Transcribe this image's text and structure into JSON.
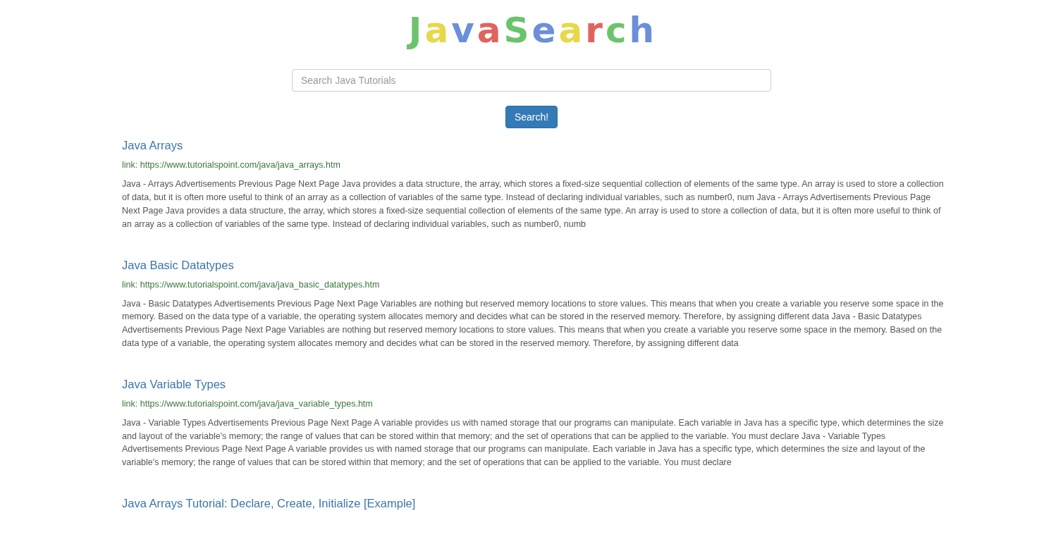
{
  "logo": {
    "letters": [
      {
        "char": "J",
        "color": "#6cc36c"
      },
      {
        "char": "a",
        "color": "#e6d84a"
      },
      {
        "char": "v",
        "color": "#6b8fd8"
      },
      {
        "char": "a",
        "color": "#e0635c"
      },
      {
        "char": "S",
        "color": "#6cc36c"
      },
      {
        "char": "e",
        "color": "#6b8fd8"
      },
      {
        "char": "a",
        "color": "#e6d84a"
      },
      {
        "char": "r",
        "color": "#e0635c"
      },
      {
        "char": "c",
        "color": "#6cc36c"
      },
      {
        "char": "h",
        "color": "#6b8fd8"
      }
    ]
  },
  "search": {
    "placeholder": "Search Java Tutorials",
    "button": "Search!"
  },
  "results": [
    {
      "title": "Java Arrays",
      "link": "link: https://www.tutorialspoint.com/java/java_arrays.htm",
      "snippet": "Java - Arrays Advertisements Previous Page Next Page   Java provides a data structure, the array, which stores a fixed-size sequential collection of elements of the same type. An array is used to store a collection of data, but it is often more useful to think of an array as a collection of variables of the same type. Instead of declaring individual variables, such as number0, num Java - Arrays Advertisements Previous Page Next Page   Java provides a data structure, the array, which stores a fixed-size sequential collection of elements of the same type. An array is used to store a collection of data, but it is often more useful to think of an array as a collection of variables of the same type. Instead of declaring individual variables, such as number0, numb"
    },
    {
      "title": "Java Basic Datatypes",
      "link": "link: https://www.tutorialspoint.com/java/java_basic_datatypes.htm",
      "snippet": "Java - Basic Datatypes Advertisements Previous Page Next Page   Variables are nothing but reserved memory locations to store values. This means that when you create a variable you reserve some space in the memory. Based on the data type of a variable, the operating system allocates memory and decides what can be stored in the reserved memory. Therefore, by assigning different data Java - Basic Datatypes Advertisements Previous Page Next Page   Variables are nothing but reserved memory locations to store values. This means that when you create a variable you reserve some space in the memory. Based on the data type of a variable, the operating system allocates memory and decides what can be stored in the reserved memory. Therefore, by assigning different data"
    },
    {
      "title": "Java Variable Types",
      "link": "link: https://www.tutorialspoint.com/java/java_variable_types.htm",
      "snippet": "Java - Variable Types Advertisements Previous Page Next Page   A variable provides us with named storage that our programs can manipulate. Each variable in Java has a specific type, which determines the size and layout of the variable's memory; the range of values that can be stored within that memory; and the set of operations that can be applied to the variable. You must declare Java - Variable Types Advertisements Previous Page Next Page   A variable provides us with named storage that our programs can manipulate. Each variable in Java has a specific type, which determines the size and layout of the variable's memory; the range of values that can be stored within that memory; and the set of operations that can be applied to the variable. You must declare"
    },
    {
      "title": "Java Arrays Tutorial: Declare, Create, Initialize [Example]"
    }
  ]
}
